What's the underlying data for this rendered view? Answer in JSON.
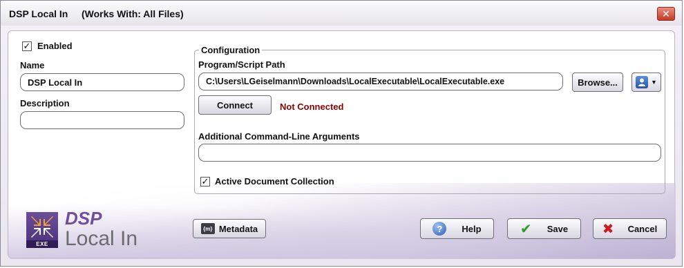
{
  "window": {
    "title": "DSP Local In",
    "works_with": "(Works With: All Files)",
    "close_symbol": "✕"
  },
  "left": {
    "enabled": {
      "label": "Enabled",
      "checked": true
    },
    "name": {
      "label": "Name",
      "value": "DSP Local In"
    },
    "description": {
      "label": "Description",
      "value": ""
    }
  },
  "configuration": {
    "legend": "Configuration",
    "program_path": {
      "label": "Program/Script Path",
      "value": "C:\\Users\\LGeiselmann\\Downloads\\LocalExecutable\\LocalExecutable.exe"
    },
    "browse_label": "Browse...",
    "connect_label": "Connect",
    "status_text": "Not Connected",
    "arguments": {
      "label": "Additional Command-Line Arguments",
      "value": ""
    },
    "active_doc": {
      "label": "Active Document Collection",
      "checked": true
    }
  },
  "logo": {
    "brand": "DSP",
    "name": "Local In",
    "badge": "EXE"
  },
  "footer": {
    "metadata_label": "Metadata",
    "help_label": "Help",
    "save_label": "Save",
    "cancel_label": "Cancel"
  },
  "icons": {
    "close": "close-icon",
    "checkmark": "checkmark-icon",
    "user_selector": "user-icon",
    "metadata": "metadata-icon",
    "help": "question-icon",
    "save": "checkmark-icon",
    "cancel": "x-icon"
  },
  "colors": {
    "status_not_connected": "#8b0000",
    "brand_purple": "#6f4e9e",
    "close_red": "#c43a26",
    "save_green": "#2e9a2e",
    "cancel_red": "#d11a1a",
    "help_blue": "#2b5fb0"
  }
}
